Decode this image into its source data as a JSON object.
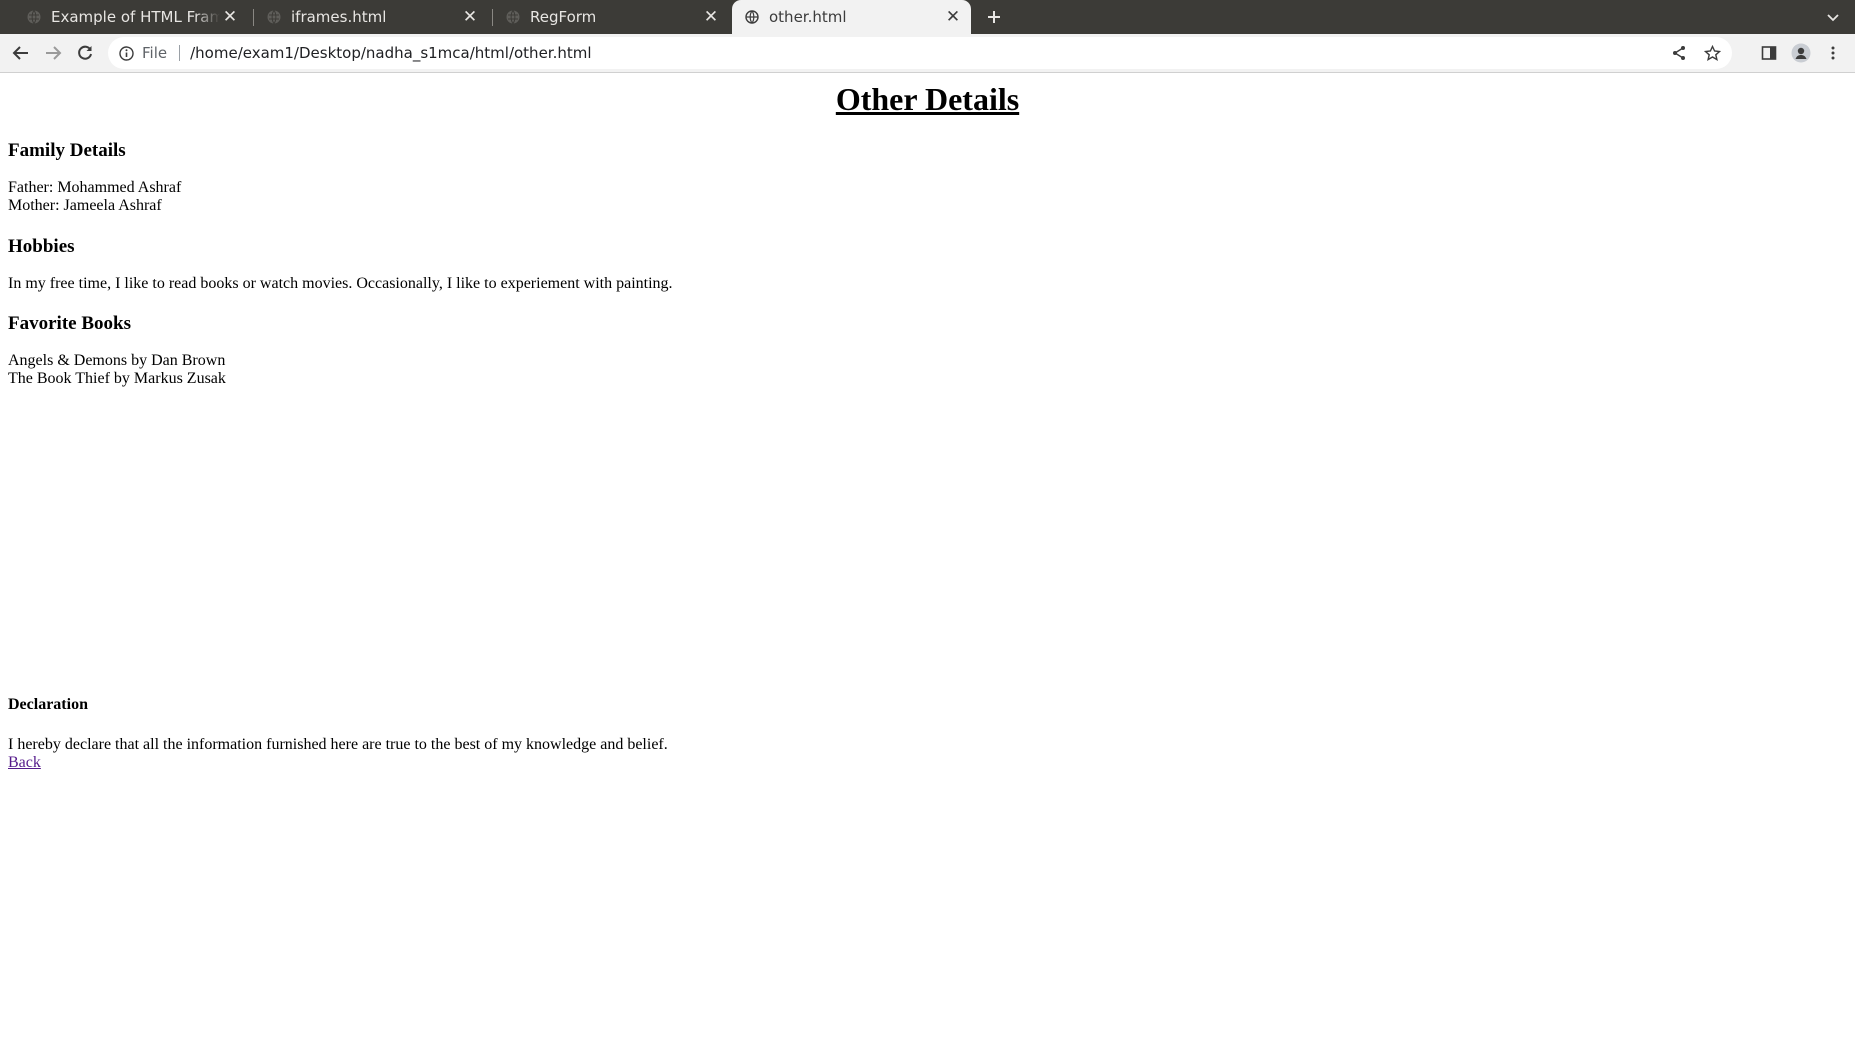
{
  "browser": {
    "tabs": [
      {
        "title": "Example of HTML Frames",
        "active": false
      },
      {
        "title": "iframes.html",
        "active": false
      },
      {
        "title": "RegForm",
        "active": false
      },
      {
        "title": "other.html",
        "active": true
      }
    ],
    "omnibox": {
      "chip": "File",
      "url": "/home/exam1/Desktop/nadha_s1mca/html/other.html"
    },
    "colors": {
      "tabstrip": "#3c3b37",
      "toolbar": "#f2f2f2",
      "link_visited": "#551a8b"
    }
  },
  "page": {
    "title": "Other Details",
    "family": {
      "heading": "Family Details",
      "father": "Father: Mohammed Ashraf",
      "mother": "Mother: Jameela Ashraf"
    },
    "hobbies": {
      "heading": "Hobbies",
      "text": "In my free time, I like to read books or watch movies. Occasionally, I like to experiement with painting."
    },
    "books": {
      "heading": "Favorite Books",
      "items": [
        "Angels & Demons by Dan Brown",
        "The Book Thief by Markus Zusak"
      ]
    },
    "declaration": {
      "heading": "Declaration",
      "text": "I hereby declare that all the information furnished here are true to the best of my knowledge and belief."
    },
    "back_link": "Back"
  }
}
